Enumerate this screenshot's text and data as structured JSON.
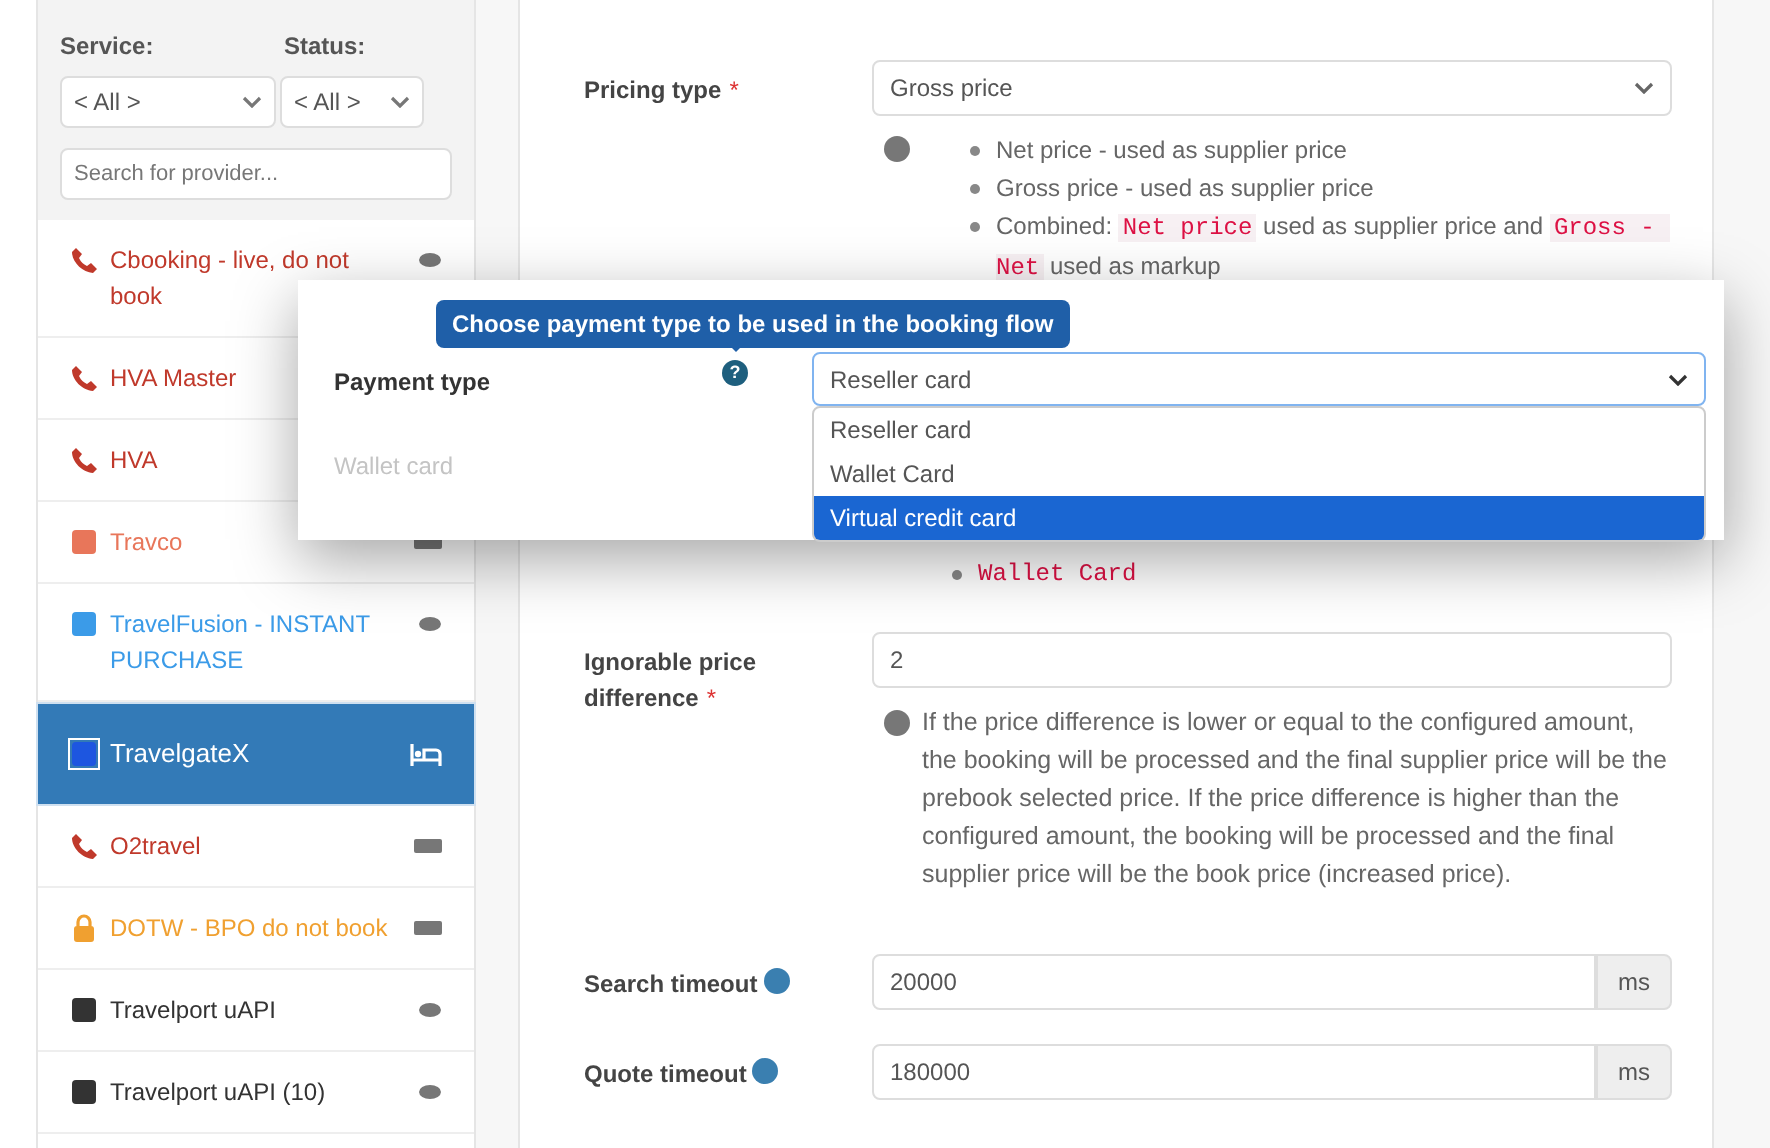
{
  "sidebar": {
    "service_label": "Service:",
    "status_label": "Status:",
    "service_value": "< All >",
    "status_value": "< All >",
    "search_placeholder": "Search for provider...",
    "providers": [
      {
        "name": "Cbooking - live, do not book",
        "kind": "phone",
        "color": "#c0392b",
        "badge": {
          "kind": "eye"
        },
        "selected": false
      },
      {
        "name": "HVA Master",
        "kind": "phone",
        "color": "#c0392b",
        "selected": false
      },
      {
        "name": "HVA",
        "kind": "phone",
        "color": "#c0392b",
        "selected": false
      },
      {
        "name": "Travco",
        "kind": "square",
        "color": "#e8765a",
        "badge": {
          "kind": "card"
        },
        "selected": false
      },
      {
        "name": "TravelFusion - INSTANT PURCHASE",
        "kind": "square",
        "color": "#3b9be8",
        "badge": {
          "kind": "eye"
        },
        "selected": false
      },
      {
        "name": "TravelgateX",
        "kind": "square",
        "color": "#1d56e0",
        "badge": {
          "kind": "bed"
        },
        "selected": true
      },
      {
        "name": "O2travel",
        "kind": "phone",
        "color": "#c0392b",
        "badge": {
          "kind": "card"
        },
        "selected": false
      },
      {
        "name": "DOTW - BPO do not book",
        "kind": "lock",
        "color": "#f0a030",
        "badge": {
          "kind": "card"
        },
        "selected": false
      },
      {
        "name": "Travelport uAPI",
        "kind": "square",
        "color": "#333333",
        "badge": {
          "kind": "eye"
        },
        "selected": false
      },
      {
        "name": "Travelport uAPI (10)",
        "kind": "square",
        "color": "#333333",
        "badge": {
          "kind": "eye"
        },
        "selected": false
      }
    ]
  },
  "form": {
    "fields": [
      {
        "kind": "select",
        "label": "Pricing type",
        "required_mark": "*",
        "value": "Gross price",
        "help_list": [
          [
            {
              "kind": "text",
              "text": "Net price - used as supplier price"
            }
          ],
          [
            {
              "kind": "text",
              "text": "Gross price - used as supplier price"
            }
          ],
          [
            {
              "kind": "text",
              "text": "Combined: "
            },
            {
              "kind": "code",
              "text": "Net price"
            },
            {
              "kind": "text",
              "text": " used as supplier price and "
            },
            {
              "kind": "code",
              "text": "Gross - Net"
            },
            {
              "kind": "text",
              "text": " used as markup"
            }
          ]
        ]
      },
      {
        "kind": "code_note",
        "value": "Wallet Card"
      },
      {
        "kind": "text",
        "label": "Ignorable price difference",
        "required_mark": "*",
        "value": "2",
        "help": "If the price difference is lower or equal to the configured amount, the booking will be processed and the final supplier price will be the prebook selected price. If the price difference is higher than the configured amount, the booking will be processed and the final supplier price will be the book price (increased price)."
      },
      {
        "kind": "unit",
        "label": "Search timeout",
        "info": true,
        "value": "20000",
        "unit": "ms"
      },
      {
        "kind": "unit",
        "label": "Quote timeout",
        "info": true,
        "value": "180000",
        "unit": "ms"
      }
    ]
  },
  "popup": {
    "label": "Payment type",
    "tooltip": "Choose payment type to be used in the booking flow",
    "help_mark": "?",
    "value": "Reseller card",
    "faded_label": "Wallet card",
    "options": [
      {
        "label": "Reseller card",
        "highlighted": false
      },
      {
        "label": "Wallet Card",
        "highlighted": false
      },
      {
        "label": "Virtual credit card",
        "highlighted": true
      }
    ]
  }
}
